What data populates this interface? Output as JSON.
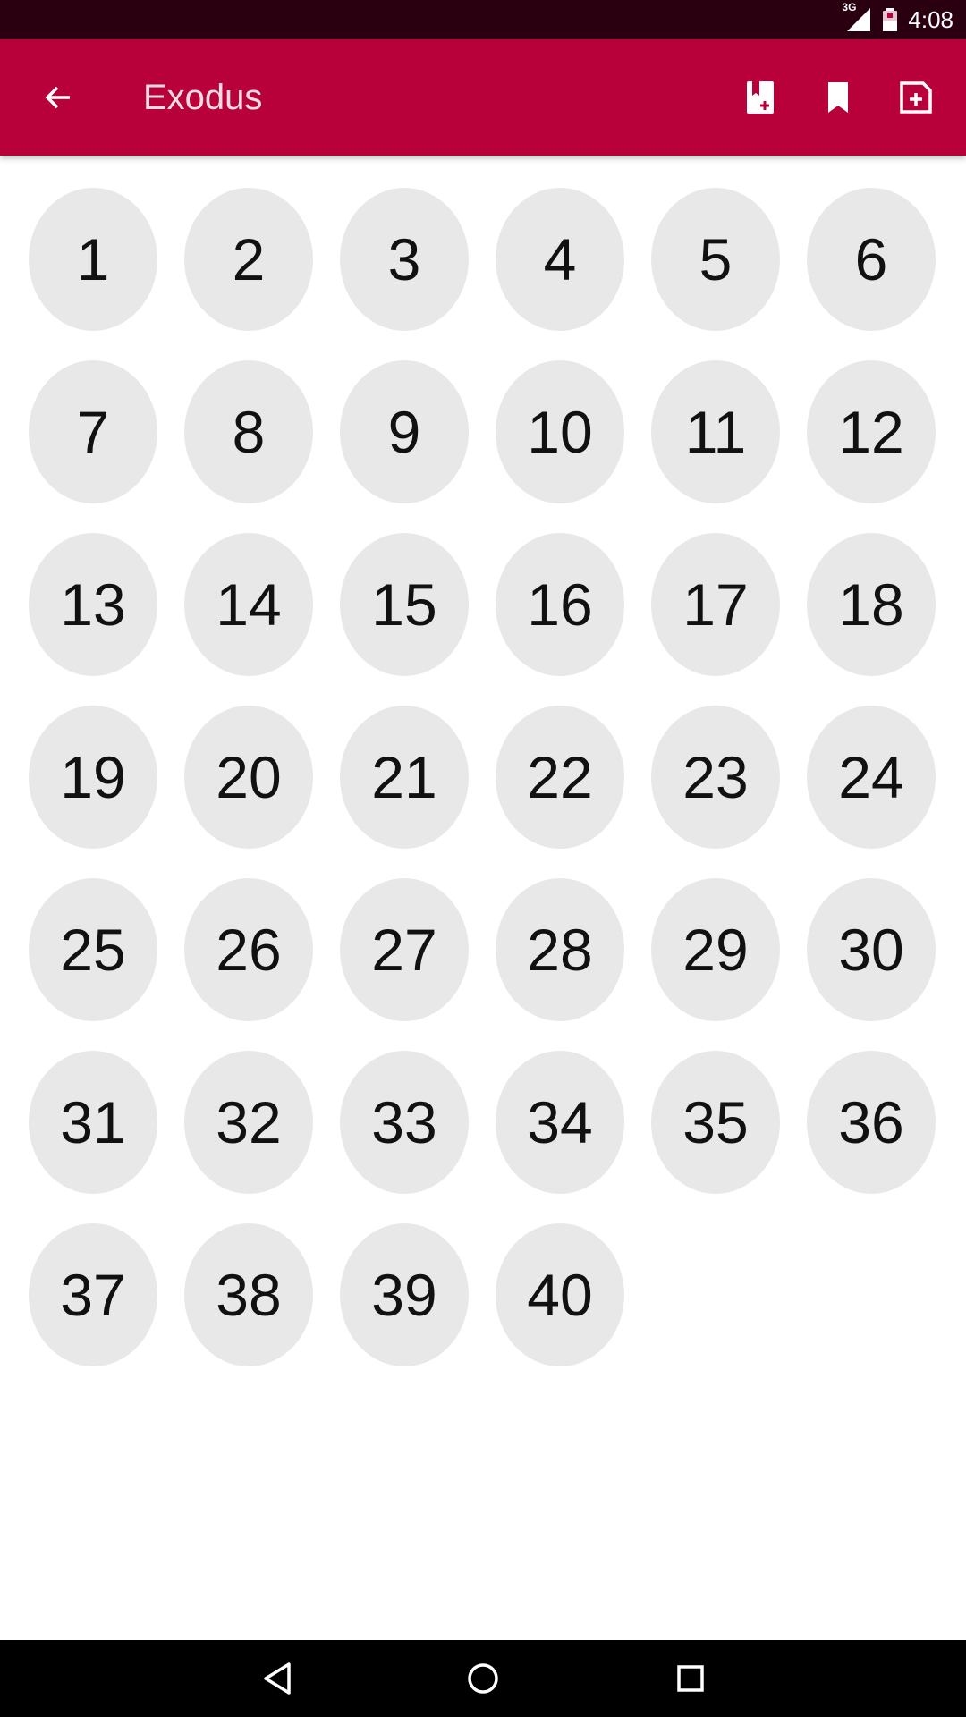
{
  "status_bar": {
    "network": "3G",
    "time": "4:08",
    "icons": [
      "signal-icon",
      "battery-icon"
    ]
  },
  "app_bar": {
    "title": "Exodus",
    "back_icon": "arrow-left-icon",
    "actions": [
      "bookmark-add-icon",
      "bookmark-icon",
      "note-add-icon"
    ]
  },
  "chapters": [
    "1",
    "2",
    "3",
    "4",
    "5",
    "6",
    "7",
    "8",
    "9",
    "10",
    "11",
    "12",
    "13",
    "14",
    "15",
    "16",
    "17",
    "18",
    "19",
    "20",
    "21",
    "22",
    "23",
    "24",
    "25",
    "26",
    "27",
    "28",
    "29",
    "30",
    "31",
    "32",
    "33",
    "34",
    "35",
    "36",
    "37",
    "38",
    "39",
    "40"
  ],
  "nav_bar": {
    "icons": [
      "back-triangle-icon",
      "home-circle-icon",
      "recents-square-icon"
    ]
  },
  "colors": {
    "status_bar": "#2a0010",
    "app_bar": "#b8003a",
    "chapter_button": "#e8e8e8",
    "nav_bar": "#000000"
  }
}
